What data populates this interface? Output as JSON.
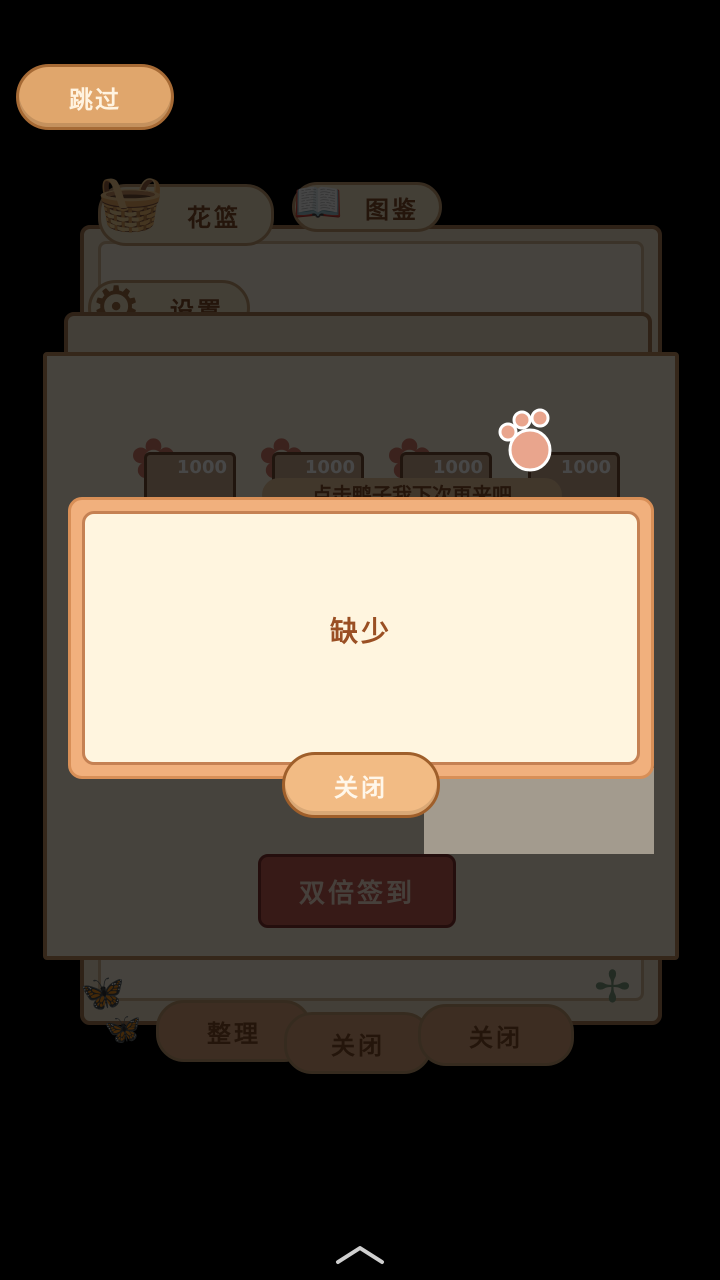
{
  "skip": {
    "label": "跳过"
  },
  "menu": {
    "basket_label": "花篮",
    "settings_label": "设置",
    "catalog_label": "图鉴"
  },
  "checkin": {
    "rewards": [
      "1000",
      "1000",
      "1000",
      "1000"
    ],
    "tip_text": "点击鸭子我下次再来吧",
    "double_label": "双倍签到"
  },
  "bottom": {
    "organize_label": "整理",
    "close_label_1": "关闭",
    "close_label_2": "关闭"
  },
  "dialog": {
    "message": "缺少",
    "close_label": "关闭"
  },
  "colors": {
    "accent": "#e0a66c",
    "dialog_border": "#f1b07d",
    "dialog_bg": "#fff5df",
    "text_brown": "#9a4f23"
  }
}
